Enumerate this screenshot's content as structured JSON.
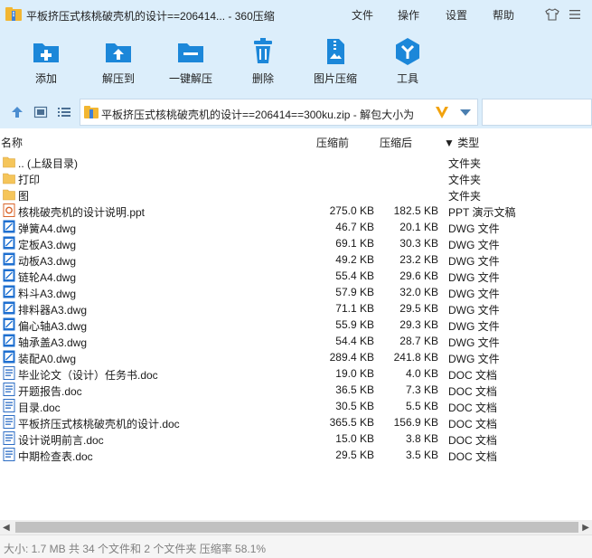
{
  "window": {
    "title": "平板挤压式核桃破壳机的设计==206414... - 360压缩",
    "menu": [
      "文件",
      "操作",
      "设置",
      "帮助"
    ]
  },
  "toolbar": {
    "add": "添加",
    "extract_to": "解压到",
    "one_click_extract": "一键解压",
    "delete": "删除",
    "image_compress": "图片压缩",
    "tools": "工具"
  },
  "address": {
    "path": "平板挤压式核桃破壳机的设计==206414==300ku.zip - 解包大小为"
  },
  "columns": {
    "name": "名称",
    "size_before": "压缩前",
    "size_after": "压缩后",
    "type": "▼ 类型"
  },
  "files": [
    {
      "name": ".. (上级目录)",
      "before": "",
      "after": "",
      "type": "文件夹",
      "icon": "folder-icon"
    },
    {
      "name": "打印",
      "before": "",
      "after": "",
      "type": "文件夹",
      "icon": "folder-icon"
    },
    {
      "name": "图",
      "before": "",
      "after": "",
      "type": "文件夹",
      "icon": "folder-icon"
    },
    {
      "name": "核桃破壳机的设计说明.ppt",
      "before": "275.0 KB",
      "after": "182.5 KB",
      "type": "PPT 演示文稿",
      "icon": "ppt-file-icon"
    },
    {
      "name": "弹簧A4.dwg",
      "before": "46.7 KB",
      "after": "20.1 KB",
      "type": "DWG 文件",
      "icon": "dwg-file-icon"
    },
    {
      "name": "定板A3.dwg",
      "before": "69.1 KB",
      "after": "30.3 KB",
      "type": "DWG 文件",
      "icon": "dwg-file-icon"
    },
    {
      "name": "动板A3.dwg",
      "before": "49.2 KB",
      "after": "23.2 KB",
      "type": "DWG 文件",
      "icon": "dwg-file-icon"
    },
    {
      "name": "链轮A4.dwg",
      "before": "55.4 KB",
      "after": "29.6 KB",
      "type": "DWG 文件",
      "icon": "dwg-file-icon"
    },
    {
      "name": "料斗A3.dwg",
      "before": "57.9 KB",
      "after": "32.0 KB",
      "type": "DWG 文件",
      "icon": "dwg-file-icon"
    },
    {
      "name": "排料器A3.dwg",
      "before": "71.1 KB",
      "after": "29.5 KB",
      "type": "DWG 文件",
      "icon": "dwg-file-icon"
    },
    {
      "name": "偏心轴A3.dwg",
      "before": "55.9 KB",
      "after": "29.3 KB",
      "type": "DWG 文件",
      "icon": "dwg-file-icon"
    },
    {
      "name": "轴承盖A3.dwg",
      "before": "54.4 KB",
      "after": "28.7 KB",
      "type": "DWG 文件",
      "icon": "dwg-file-icon"
    },
    {
      "name": "装配A0.dwg",
      "before": "289.4 KB",
      "after": "241.8 KB",
      "type": "DWG 文件",
      "icon": "dwg-file-icon"
    },
    {
      "name": "毕业论文（设计）任务书.doc",
      "before": "19.0 KB",
      "after": "4.0 KB",
      "type": "DOC 文档",
      "icon": "doc-file-icon"
    },
    {
      "name": "开题报告.doc",
      "before": "36.5 KB",
      "after": "7.3 KB",
      "type": "DOC 文档",
      "icon": "doc-file-icon"
    },
    {
      "name": "目录.doc",
      "before": "30.5 KB",
      "after": "5.5 KB",
      "type": "DOC 文档",
      "icon": "doc-file-icon"
    },
    {
      "name": "平板挤压式核桃破壳机的设计.doc",
      "before": "365.5 KB",
      "after": "156.9 KB",
      "type": "DOC 文档",
      "icon": "doc-file-icon"
    },
    {
      "name": "设计说明前言.doc",
      "before": "15.0 KB",
      "after": "3.8 KB",
      "type": "DOC 文档",
      "icon": "doc-file-icon"
    },
    {
      "name": "中期检查表.doc",
      "before": "29.5 KB",
      "after": "3.5 KB",
      "type": "DOC 文档",
      "icon": "doc-file-icon"
    }
  ],
  "status": {
    "text": "大小: 1.7 MB 共 34 个文件和 2 个文件夹 压缩率 58.1%"
  },
  "colors": {
    "chrome_bg": "#dceefb",
    "toolbar_icon": "#1c87d9",
    "folder": "#f5c55a",
    "dwg": "#1e6fd0",
    "doc": "#2b6cc4",
    "ppt": "#d9642a"
  }
}
